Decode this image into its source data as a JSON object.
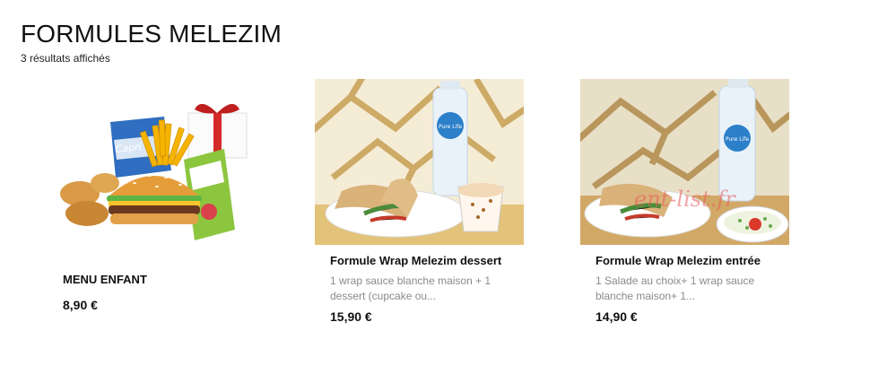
{
  "page": {
    "title": "FORMULES MELEZIM",
    "results_count": "3 résultats affichés"
  },
  "products": [
    {
      "name": "MENU ENFANT",
      "description": "",
      "price": "8,90 €",
      "image": "kids-menu-burger-nuggets-fries-juice"
    },
    {
      "name": "Formule Wrap Melezim dessert",
      "description": "1 wrap  sauce blanche maison + 1 dessert (cupcake ou...",
      "price": "15,90 €",
      "image": "wrap-water-dessert-cup"
    },
    {
      "name": "Formule Wrap Melezim entrée",
      "description": "1 Salade au choix+ 1 wrap  sauce blanche maison+ 1...",
      "price": "14,90 €",
      "image": "wrap-water-salad-bowl",
      "watermark": "ent-list.fr"
    }
  ],
  "colors": {
    "price": "#111111",
    "description": "#8a8a8a"
  }
}
